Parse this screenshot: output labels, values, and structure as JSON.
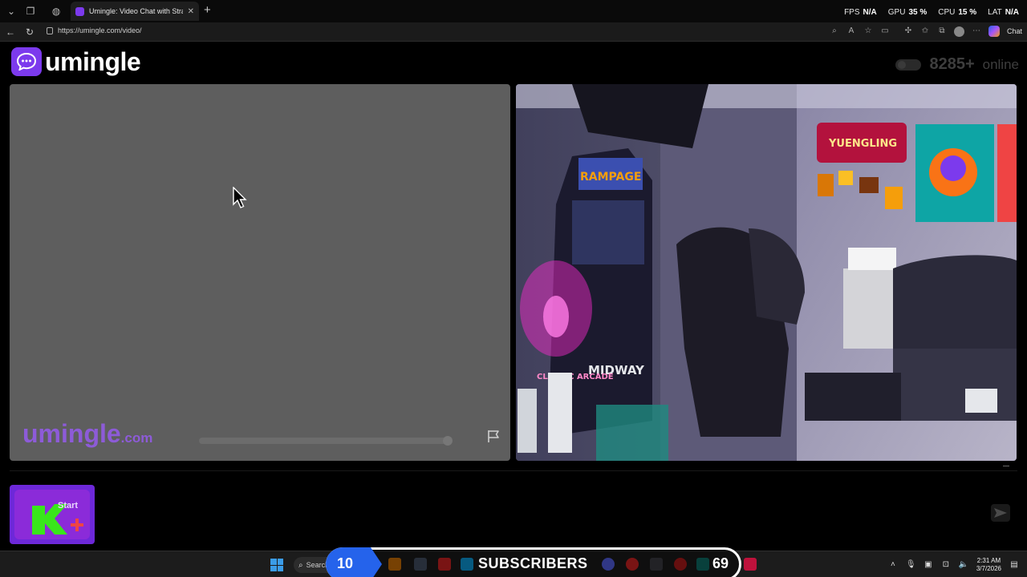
{
  "browser": {
    "tab_title": "Umingle: Video Chat with Stra",
    "url": "https://umingle.com/video/",
    "chat_label": "Chat",
    "stats": [
      {
        "key": "FPS",
        "value": "N/A"
      },
      {
        "key": "GPU",
        "value": "35 %"
      },
      {
        "key": "CPU",
        "value": "15 %"
      },
      {
        "key": "LAT",
        "value": "N/A"
      }
    ]
  },
  "page": {
    "logo_text": "umingle",
    "online_count": "8285+",
    "online_label": "online",
    "watermark_main": "umingle",
    "watermark_suffix": ".com",
    "start_label": "Start",
    "accent": "#7c3aed",
    "partner_scene_labels": [
      "YUENGLING",
      "MIDWAY",
      "CLASSIC ARCADE",
      "RAMPAGE"
    ]
  },
  "taskbar": {
    "search_label": "Search",
    "time": "2:31 AM",
    "date": "3/7/2026"
  },
  "overlay": {
    "count_left": "10",
    "label": "SUBSCRIBERS",
    "count_right": "69"
  }
}
